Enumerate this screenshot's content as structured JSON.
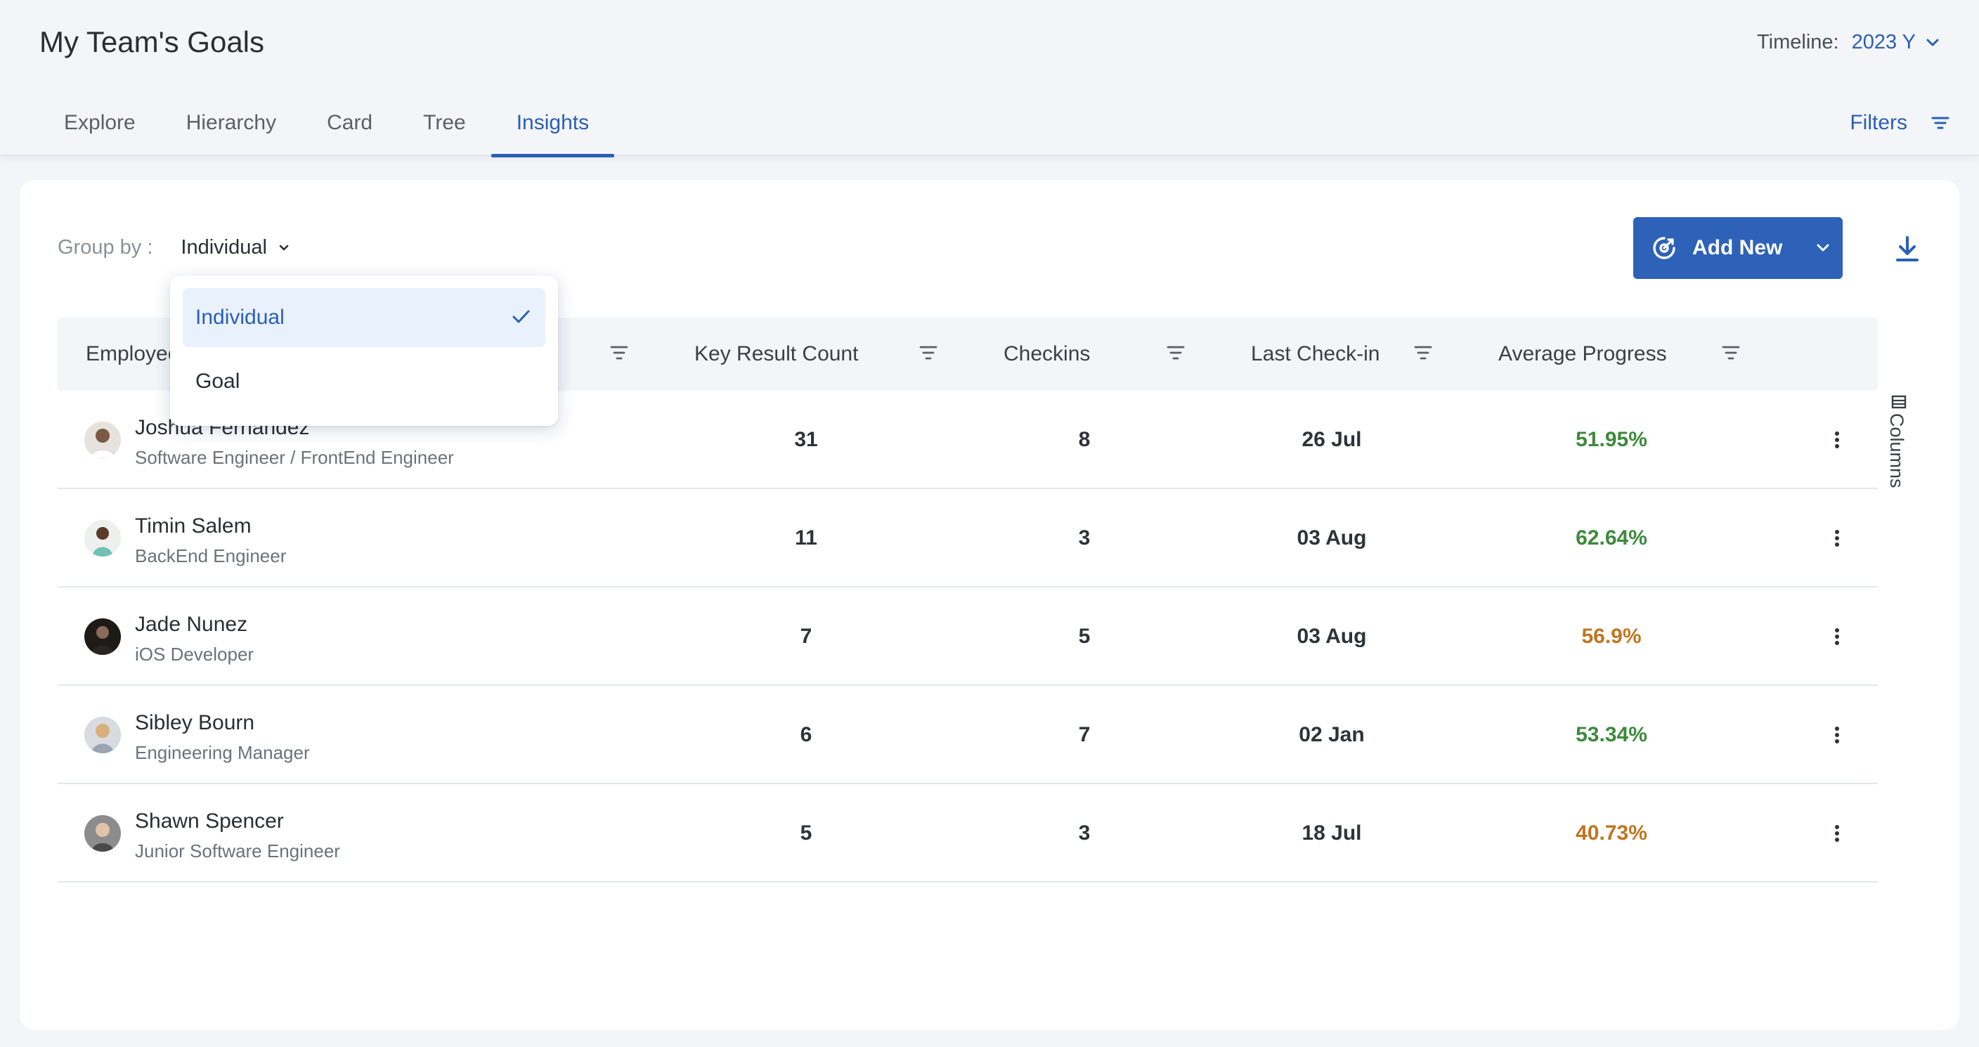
{
  "header": {
    "title": "My Team's Goals",
    "timeline_label": "Timeline:",
    "timeline_value": "2023 Y",
    "filters_label": "Filters"
  },
  "tabs": [
    {
      "label": "Explore",
      "active": false
    },
    {
      "label": "Hierarchy",
      "active": false
    },
    {
      "label": "Card",
      "active": false
    },
    {
      "label": "Tree",
      "active": false
    },
    {
      "label": "Insights",
      "active": true
    }
  ],
  "toolbar": {
    "group_by_label": "Group by :",
    "group_by_value": "Individual",
    "add_new_label": "Add New"
  },
  "dropdown": {
    "options": [
      "Individual",
      "Goal"
    ],
    "selected": "Individual"
  },
  "table": {
    "columns": [
      "Employee",
      "Key Result Count",
      "Checkins",
      "Last Check-in",
      "Average Progress"
    ],
    "rows": [
      {
        "name": "Joshua Fernandez",
        "role": "Software Engineer / FrontEnd Engineer",
        "kr_count": "31",
        "checkins": "8",
        "last_checkin": "26 Jul",
        "avg_progress": "51.95%",
        "status": "good"
      },
      {
        "name": "Timin Salem",
        "role": "BackEnd Engineer",
        "kr_count": "11",
        "checkins": "3",
        "last_checkin": "03 Aug",
        "avg_progress": "62.64%",
        "status": "good"
      },
      {
        "name": "Jade Nunez",
        "role": "iOS Developer",
        "kr_count": "7",
        "checkins": "5",
        "last_checkin": "03 Aug",
        "avg_progress": "56.9%",
        "status": "warn"
      },
      {
        "name": "Sibley Bourn",
        "role": "Engineering Manager",
        "kr_count": "6",
        "checkins": "7",
        "last_checkin": "02 Jan",
        "avg_progress": "53.34%",
        "status": "good"
      },
      {
        "name": "Shawn Spencer",
        "role": "Junior Software Engineer",
        "kr_count": "5",
        "checkins": "3",
        "last_checkin": "18 Jul",
        "avg_progress": "40.73%",
        "status": "warn"
      }
    ]
  },
  "columns_toggle_label": "Columns",
  "colors": {
    "accent": "#2b5fb4",
    "good": "#3c8a3c",
    "warn": "#c07520"
  }
}
